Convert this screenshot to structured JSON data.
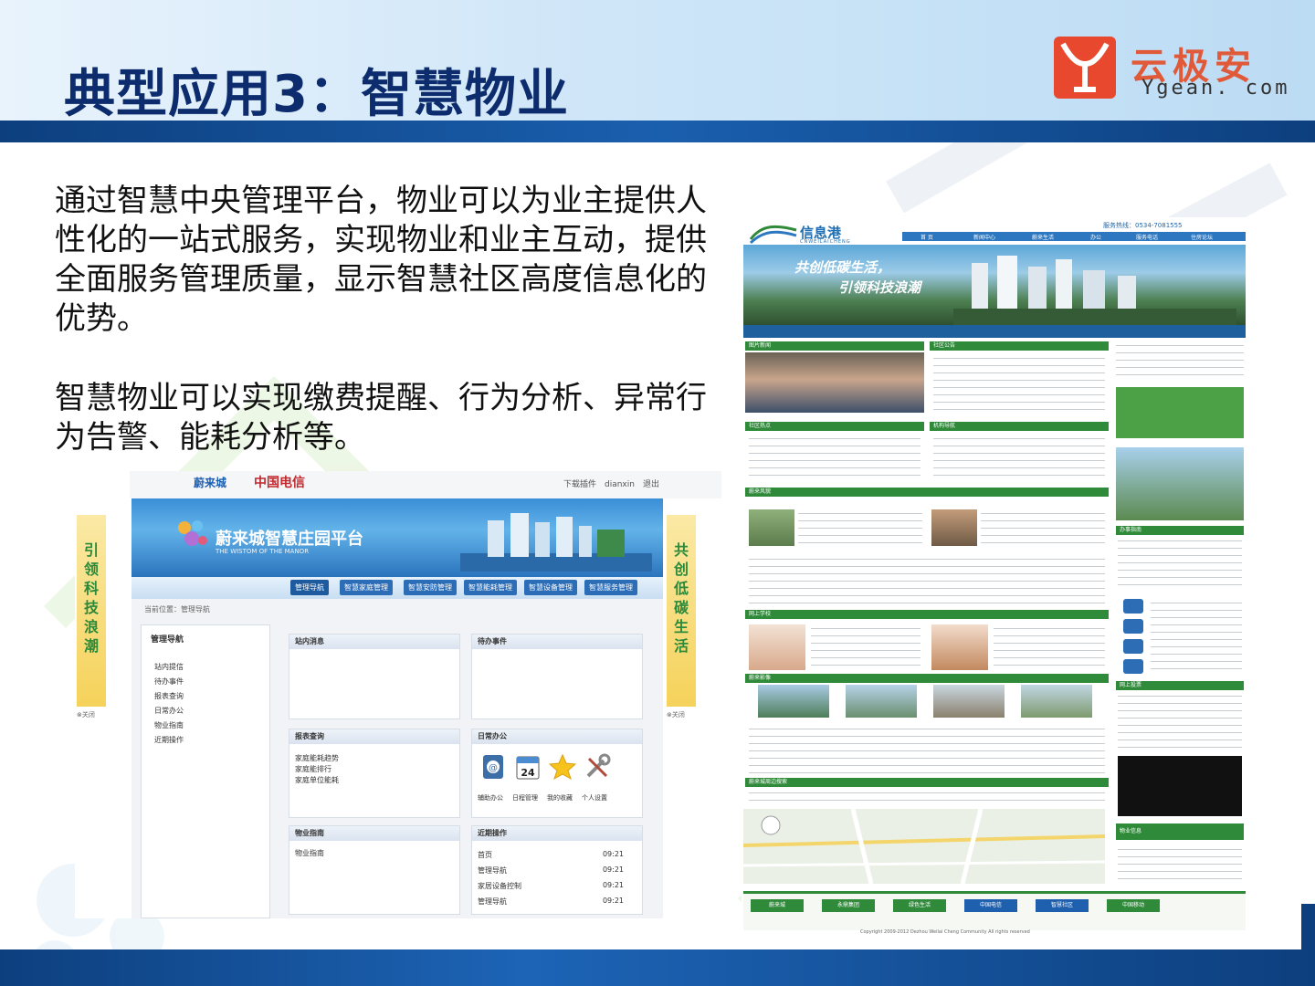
{
  "title": "典型应用3：智慧物业",
  "logo": {
    "cn": "云极安",
    "en": "Ygean. com"
  },
  "paragraphs": [
    "通过智慧中央管理平台，物业可以为业主提供人性化的一站式服务，实现物业和业主互动，提供全面服务管理质量，显示智慧社区高度信息化的优势。",
    "智慧物业可以实现缴费提醒、行为分析、异常行为告警、能耗分析等。"
  ],
  "manor": {
    "brand": "蔚来城",
    "telecom": "中国电信",
    "top_links": "下载插件　dianxin　退出",
    "banner_title": "蔚来城智慧庄园平台",
    "banner_sub": "THE WISTOM OF THE MANOR",
    "nav": [
      "管理导航",
      "智慧家庭管理",
      "智慧安防管理",
      "智慧能耗管理",
      "智慧设备管理",
      "智慧服务管理"
    ],
    "left_slogan": "引领科技浪潮",
    "right_slogan": "共创低碳生活",
    "side_close": "⊗关闭",
    "crumb": "当前位置：管理导航",
    "menu_title": "管理导航",
    "menu_items": [
      "站内提信",
      "待办事件",
      "报表查询",
      "日常办公",
      "物业指南",
      "近期操作"
    ],
    "panels": {
      "inbox": "站内消息",
      "todo": "待办事件",
      "report": "报表查询",
      "report_lines": [
        "家庭能耗趋势",
        "家庭能排行",
        "家庭单位能耗"
      ],
      "office": "日常办公",
      "office_icons": [
        "辅助办公",
        "日程管理",
        "我的收藏",
        "个人设置"
      ],
      "calendar_day": "24",
      "guide": "物业指南",
      "guide_line": "物业指南",
      "recent": "近期操作",
      "recent_rows": [
        {
          "label": "首页",
          "time": "09:21"
        },
        {
          "label": "管理导航",
          "time": "09:21"
        },
        {
          "label": "家居设备控制",
          "time": "09:21"
        },
        {
          "label": "管理导航",
          "time": "09:21"
        }
      ]
    }
  },
  "portal": {
    "logo": "信息港",
    "logo_sub": "CNWEILAICHENG",
    "hotline": "服务热线：0534-7081555",
    "nav": [
      "首 页",
      "新闻中心",
      "蔚来生活",
      "办公",
      "服务电话",
      "住房论坛"
    ],
    "banner_line1": "共创低碳生活，",
    "banner_line2": "引领科技浪潮",
    "sections": [
      "图片新闻",
      "社区公告",
      "社区热点",
      "机构导航",
      "蔚来风貌",
      "网上学校",
      "蔚来影像",
      "蔚来城周边搜索",
      "办事指南",
      "网上投票",
      "物业信息"
    ],
    "footer_logos": [
      "蔚来城",
      "永鼎集团",
      "绿色生活",
      "中国电信",
      "智慧社区",
      "中国移动"
    ],
    "copyright": "Copyright 2009-2012 Dezhou Weilai Cheng Community All rights reserved"
  },
  "colors": {
    "title": "#0c2c6e",
    "header_bar": "#0d3f7e",
    "logo_red": "#e05a3a",
    "text": "#111111"
  }
}
